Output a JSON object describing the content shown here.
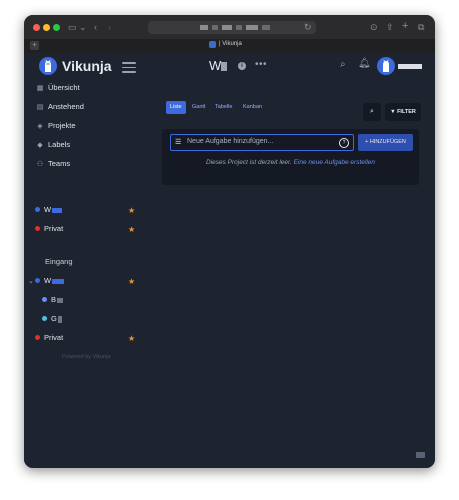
{
  "browser": {
    "tab_title": "| Vikunja",
    "new_tab_symbol": "+"
  },
  "app": {
    "logo_text": "Vikunja",
    "project_title_initial": "W",
    "more_symbol": "•••"
  },
  "sidebar": {
    "nav": [
      {
        "label": "Übersicht",
        "icon": "calendar-icon",
        "glyph": "▦"
      },
      {
        "label": "Anstehend",
        "icon": "calendar-upcoming-icon",
        "glyph": "▤"
      },
      {
        "label": "Projekte",
        "icon": "layer-group-icon",
        "glyph": "◈"
      },
      {
        "label": "Labels",
        "icon": "tags-icon",
        "glyph": "◆"
      },
      {
        "label": "Teams",
        "icon": "users-icon",
        "glyph": "⚇"
      }
    ],
    "favorites": [
      {
        "label": "W",
        "dot_color": "#3e6ae0",
        "favorite": true
      },
      {
        "label": "Privat",
        "dot_color": "#e0302b",
        "favorite": true
      }
    ],
    "projects_heading": "Eingang",
    "projects": [
      {
        "label": "W",
        "dot_color": "#3e6ae0",
        "favorite": true,
        "expanded": true
      },
      {
        "label": "B",
        "dot_color": "#6b8fee",
        "child": true
      },
      {
        "label": "G",
        "dot_color": "#4ec0e0",
        "child": true
      },
      {
        "label": "Privat",
        "dot_color": "#e0302b",
        "favorite": true
      }
    ],
    "powered_by": "Powered by Vikunja"
  },
  "views": {
    "tabs": [
      "Liste",
      "Gantt",
      "Tabelle",
      "Kanban"
    ],
    "active": "Liste",
    "filter_label": "FILTER"
  },
  "task_input": {
    "placeholder": "Neue Aufgabe hinzufügen...",
    "add_button": "+ HINZUFÜGEN"
  },
  "empty_state": {
    "text": "Dieses Project ist derzeit leer.",
    "link": "Eine neue Aufgabe erstellen"
  },
  "colors": {
    "background": "#1e2330",
    "card": "#151923",
    "accent": "#3e6ae0",
    "favorite_star": "#f0932b"
  }
}
